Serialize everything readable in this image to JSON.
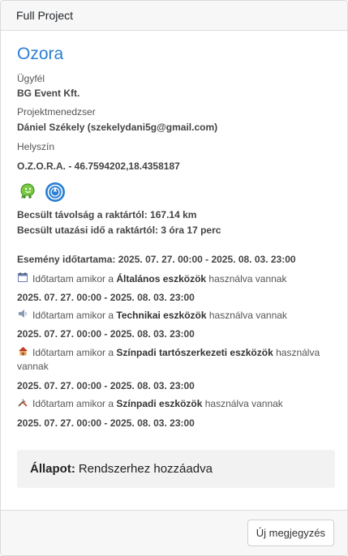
{
  "header": {
    "title": "Full Project"
  },
  "project": {
    "name": "Ozora",
    "client_label": "Ügyfél",
    "client_value": "BG Event Kft.",
    "manager_label": "Projektmenedzser",
    "manager_value": "Dániel Székely (szekelydani5g@gmail.com)",
    "location_label": "Helyszín",
    "location_value": "O.Z.O.R.A. - 46.7594202,18.4358187",
    "distance_text": "Becsült távolság a raktártól: 167.14 km",
    "travel_text": "Becsült utazási idő a raktártól: 3 óra 17 perc",
    "event_range_text": "Esemény időtartama: 2025. 07. 27. 00:00 - 2025. 08. 03. 23:00"
  },
  "usage_rows": [
    {
      "icon": "calendar-icon",
      "prefix": "Időtartam amikor a ",
      "category": "Általános eszközök",
      "suffix": " használva vannak",
      "range": "2025. 07. 27. 00:00 - 2025. 08. 03. 23:00"
    },
    {
      "icon": "speaker-icon",
      "prefix": "Időtartam amikor a ",
      "category": "Technikai eszközök",
      "suffix": " használva vannak",
      "range": "2025. 07. 27. 00:00 - 2025. 08. 03. 23:00"
    },
    {
      "icon": "house-icon",
      "prefix": "Időtartam amikor a ",
      "category": "Színpadi tartószerkezeti eszközök",
      "suffix": " használva",
      "suffix2": "vannak",
      "range": "2025. 07. 27. 00:00 - 2025. 08. 03. 23:00"
    },
    {
      "icon": "tools-icon",
      "prefix": "Időtartam amikor a ",
      "category": "Színpadi eszközök",
      "suffix": " használva vannak",
      "range": "2025. 07. 27. 00:00 - 2025. 08. 03. 23:00"
    }
  ],
  "status": {
    "label": "Állapot:",
    "value": "Rendszerhez hozzáadva"
  },
  "footer": {
    "new_note_label": "Új megjegyzés"
  },
  "colors": {
    "accent": "#2a7fd4",
    "waze": "#33ccff"
  }
}
